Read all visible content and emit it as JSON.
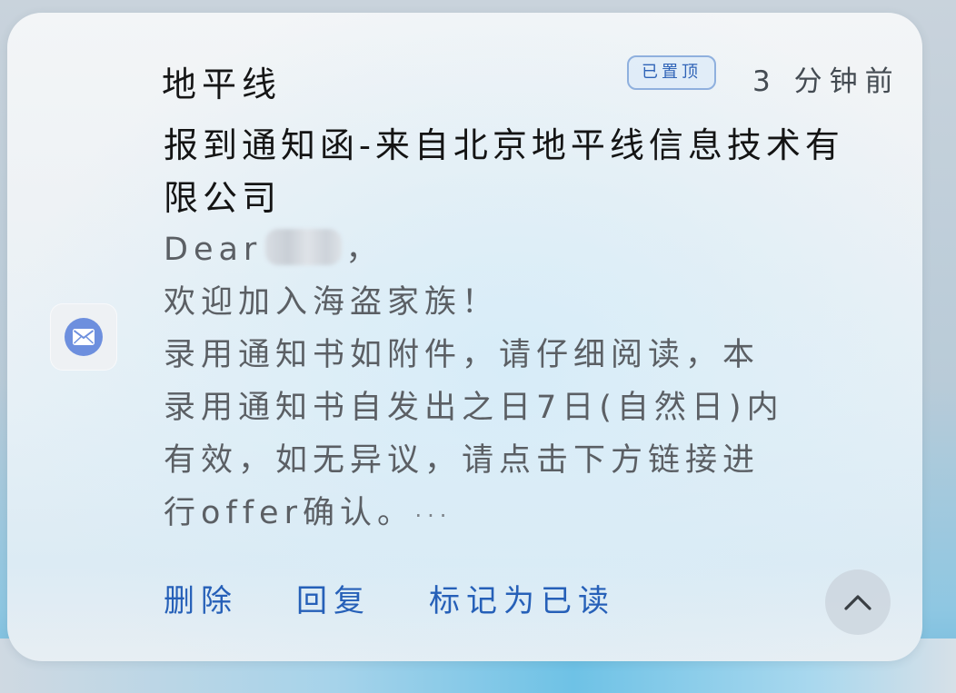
{
  "notification": {
    "sender": "地平线",
    "pinned_badge": "已置顶",
    "time_ago": "3 分钟前",
    "subject": "报到通知函-来自北京地平线信息技术有限公司",
    "preview": {
      "greeting_prefix": "Dear",
      "greeting_suffix": "，",
      "line2": "欢迎加入海盗家族！",
      "line3": "录用通知书如附件，请仔细阅读，本",
      "line4": "录用通知书自发出之日7日(自然日)内",
      "line5": "有效，如无异议，请点击下方链接进",
      "line6": "行offer确认。",
      "more": "···"
    },
    "app_icon": "mail-icon",
    "actions": {
      "delete": "删除",
      "reply": "回复",
      "mark_read": "标记为已读"
    },
    "collapse_icon": "chevron-up-icon",
    "accent_color": "#2660b8"
  }
}
